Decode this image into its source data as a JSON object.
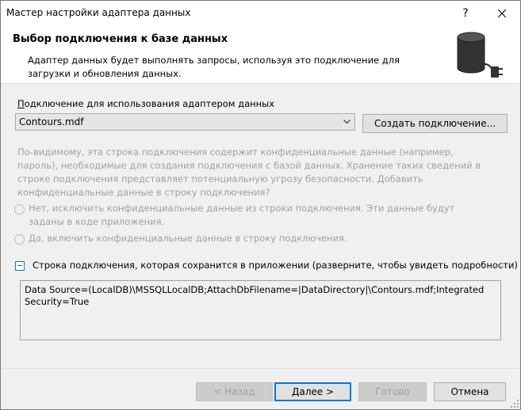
{
  "window": {
    "title": "Мастер настройки адаптера данных",
    "help_glyph": "?",
    "close_glyph": "✕"
  },
  "header": {
    "title": "Выбор подключения к базе данных",
    "description": "Адаптер данных будет выполнять запросы, используя это подключение для загрузки и обновления данных.",
    "icon": "database-plug-icon"
  },
  "connection": {
    "label_prefix": "П",
    "label_rest": "одключение для использования адаптером данных",
    "selected_value": "Contours.mdf",
    "new_connection_button": "Создать подключение..."
  },
  "sensitive": {
    "text": "По-видимому, эта строка подключения содержит конфиденциальные данные (например, пароль), необходимые для создания подключения с базой данных. Хранение таких сведений в строке подключения представляет потенциальную угрозу безопасности. Добавить конфиденциальные данные в строку подключения?",
    "option_no": "Нет, исключить конфиденциальные данные из строки подключения. Эти данные будут заданы в коде приложения.",
    "option_yes": "Да, включить конфиденциальные данные в строку подключения."
  },
  "connection_string": {
    "expander_label": "Строка подключения, которая сохранится в приложении (разверните, чтобы увидеть подробности)",
    "value": "Data Source=(LocalDB)\\MSSQLLocalDB;AttachDbFilename=|DataDirectory|\\Contours.mdf;Integrated Security=True"
  },
  "footer": {
    "back": "< Назад",
    "next": "Далее >",
    "finish": "Готово",
    "cancel": "Отмена"
  }
}
